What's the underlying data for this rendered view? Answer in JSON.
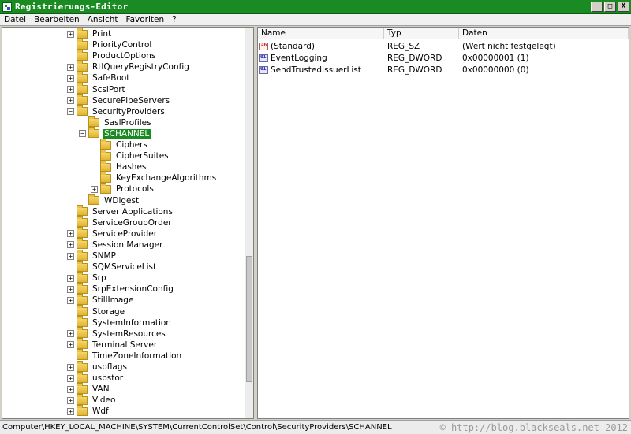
{
  "window": {
    "title": "Registrierungs-Editor",
    "minimize": "_",
    "maximize": "□",
    "close": "X"
  },
  "menu": [
    {
      "label": "Datei"
    },
    {
      "label": "Bearbeiten"
    },
    {
      "label": "Ansicht"
    },
    {
      "label": "Favoriten"
    },
    {
      "label": "?"
    }
  ],
  "tree": [
    {
      "label": "Print",
      "expander": "+",
      "level": 0
    },
    {
      "label": "PriorityControl",
      "expander": "",
      "level": 0
    },
    {
      "label": "ProductOptions",
      "expander": "",
      "level": 0
    },
    {
      "label": "RtlQueryRegistryConfig",
      "expander": "+",
      "level": 0
    },
    {
      "label": "SafeBoot",
      "expander": "+",
      "level": 0
    },
    {
      "label": "ScsiPort",
      "expander": "+",
      "level": 0
    },
    {
      "label": "SecurePipeServers",
      "expander": "+",
      "level": 0
    },
    {
      "label": "SecurityProviders",
      "expander": "−",
      "level": 0
    },
    {
      "label": "SaslProfiles",
      "expander": "",
      "level": 1
    },
    {
      "label": "SCHANNEL",
      "expander": "−",
      "level": 1,
      "selected": true
    },
    {
      "label": "Ciphers",
      "expander": "",
      "level": 2
    },
    {
      "label": "CipherSuites",
      "expander": "",
      "level": 2
    },
    {
      "label": "Hashes",
      "expander": "",
      "level": 2
    },
    {
      "label": "KeyExchangeAlgorithms",
      "expander": "",
      "level": 2
    },
    {
      "label": "Protocols",
      "expander": "+",
      "level": 2
    },
    {
      "label": "WDigest",
      "expander": "",
      "level": 1
    },
    {
      "label": "Server Applications",
      "expander": "",
      "level": 0
    },
    {
      "label": "ServiceGroupOrder",
      "expander": "",
      "level": 0
    },
    {
      "label": "ServiceProvider",
      "expander": "+",
      "level": 0
    },
    {
      "label": "Session Manager",
      "expander": "+",
      "level": 0
    },
    {
      "label": "SNMP",
      "expander": "+",
      "level": 0
    },
    {
      "label": "SQMServiceList",
      "expander": "",
      "level": 0
    },
    {
      "label": "Srp",
      "expander": "+",
      "level": 0
    },
    {
      "label": "SrpExtensionConfig",
      "expander": "+",
      "level": 0
    },
    {
      "label": "StillImage",
      "expander": "+",
      "level": 0
    },
    {
      "label": "Storage",
      "expander": "",
      "level": 0
    },
    {
      "label": "SystemInformation",
      "expander": "",
      "level": 0
    },
    {
      "label": "SystemResources",
      "expander": "+",
      "level": 0
    },
    {
      "label": "Terminal Server",
      "expander": "+",
      "level": 0
    },
    {
      "label": "TimeZoneInformation",
      "expander": "",
      "level": 0
    },
    {
      "label": "usbflags",
      "expander": "+",
      "level": 0
    },
    {
      "label": "usbstor",
      "expander": "+",
      "level": 0
    },
    {
      "label": "VAN",
      "expander": "+",
      "level": 0
    },
    {
      "label": "Video",
      "expander": "+",
      "level": 0
    },
    {
      "label": "Wdf",
      "expander": "+",
      "level": 0
    }
  ],
  "list": {
    "columns": [
      "Name",
      "Typ",
      "Daten"
    ],
    "rows": [
      {
        "icon": "string-value-icon",
        "iconText": "ab",
        "name": "(Standard)",
        "type": "REG_SZ",
        "data": "(Wert nicht festgelegt)"
      },
      {
        "icon": "binary-value-icon",
        "iconText": "011",
        "name": "EventLogging",
        "type": "REG_DWORD",
        "data": "0x00000001 (1)"
      },
      {
        "icon": "binary-value-icon",
        "iconText": "011",
        "name": "SendTrustedIssuerList",
        "type": "REG_DWORD",
        "data": "0x00000000 (0)"
      }
    ]
  },
  "status": {
    "path": "Computer\\HKEY_LOCAL_MACHINE\\SYSTEM\\CurrentControlSet\\Control\\SecurityProviders\\SCHANNEL",
    "watermark": "© http://blog.blackseals.net 2012"
  }
}
